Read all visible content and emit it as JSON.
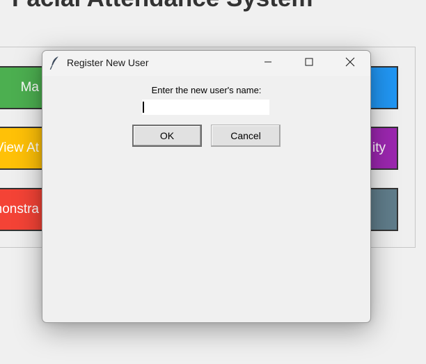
{
  "app": {
    "title": "Facial Attendance System",
    "buttons": {
      "mark": {
        "label": "Ma",
        "color": "#4caf50"
      },
      "view": {
        "label": "View At",
        "color": "#ffc107"
      },
      "demo": {
        "label": "nonstra",
        "color": "#f44336"
      },
      "blue": {
        "label": "",
        "color": "#2196f3"
      },
      "activity": {
        "label": "ity",
        "color": "#9c27b0"
      },
      "slate": {
        "label": "",
        "color": "#607d8b"
      }
    }
  },
  "dialog": {
    "title": "Register New User",
    "icon": "feather-icon",
    "prompt": "Enter the new user's name:",
    "input_value": "",
    "ok_label": "OK",
    "cancel_label": "Cancel",
    "window_controls": [
      "minimize-icon",
      "maximize-icon",
      "close-icon"
    ]
  }
}
